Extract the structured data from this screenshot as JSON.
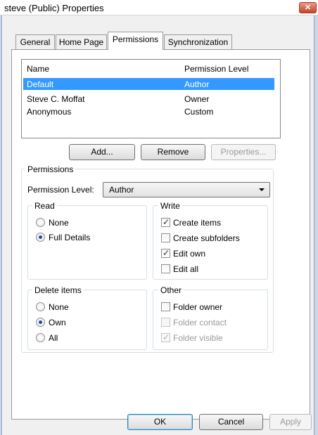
{
  "window": {
    "title": "steve (Public) Properties",
    "close_glyph": "✕"
  },
  "tabs": [
    {
      "label": "General",
      "active": false
    },
    {
      "label": "Home Page",
      "active": false
    },
    {
      "label": "Permissions",
      "active": true
    },
    {
      "label": "Synchronization",
      "active": false
    }
  ],
  "list": {
    "columns": [
      "Name",
      "Permission Level"
    ],
    "rows": [
      {
        "name": "Default",
        "level": "Author",
        "selected": true
      },
      {
        "name": "Steve C. Moffat",
        "level": "Owner",
        "selected": false
      },
      {
        "name": "Anonymous",
        "level": "Custom",
        "selected": false
      }
    ]
  },
  "list_buttons": {
    "add": "Add...",
    "remove": "Remove",
    "properties": "Properties..."
  },
  "permissions": {
    "group_label": "Permissions",
    "level_label": "Permission Level:",
    "level_value": "Author",
    "read": {
      "label": "Read",
      "options": [
        "None",
        "Full Details"
      ],
      "selected": "Full Details"
    },
    "write": {
      "label": "Write",
      "items": [
        {
          "label": "Create items",
          "checked": true,
          "enabled": true
        },
        {
          "label": "Create subfolders",
          "checked": false,
          "enabled": true
        },
        {
          "label": "Edit own",
          "checked": true,
          "enabled": true
        },
        {
          "label": "Edit all",
          "checked": false,
          "enabled": true
        }
      ]
    },
    "delete": {
      "label": "Delete items",
      "options": [
        "None",
        "Own",
        "All"
      ],
      "selected": "Own"
    },
    "other": {
      "label": "Other",
      "items": [
        {
          "label": "Folder owner",
          "checked": false,
          "enabled": true
        },
        {
          "label": "Folder contact",
          "checked": false,
          "enabled": false
        },
        {
          "label": "Folder visible",
          "checked": true,
          "enabled": false
        }
      ]
    }
  },
  "footer": {
    "ok": "OK",
    "cancel": "Cancel",
    "apply": "Apply"
  },
  "check_glyph": "✓",
  "colors": {
    "selection": "#3399ff",
    "title_close": "#c4452c"
  }
}
